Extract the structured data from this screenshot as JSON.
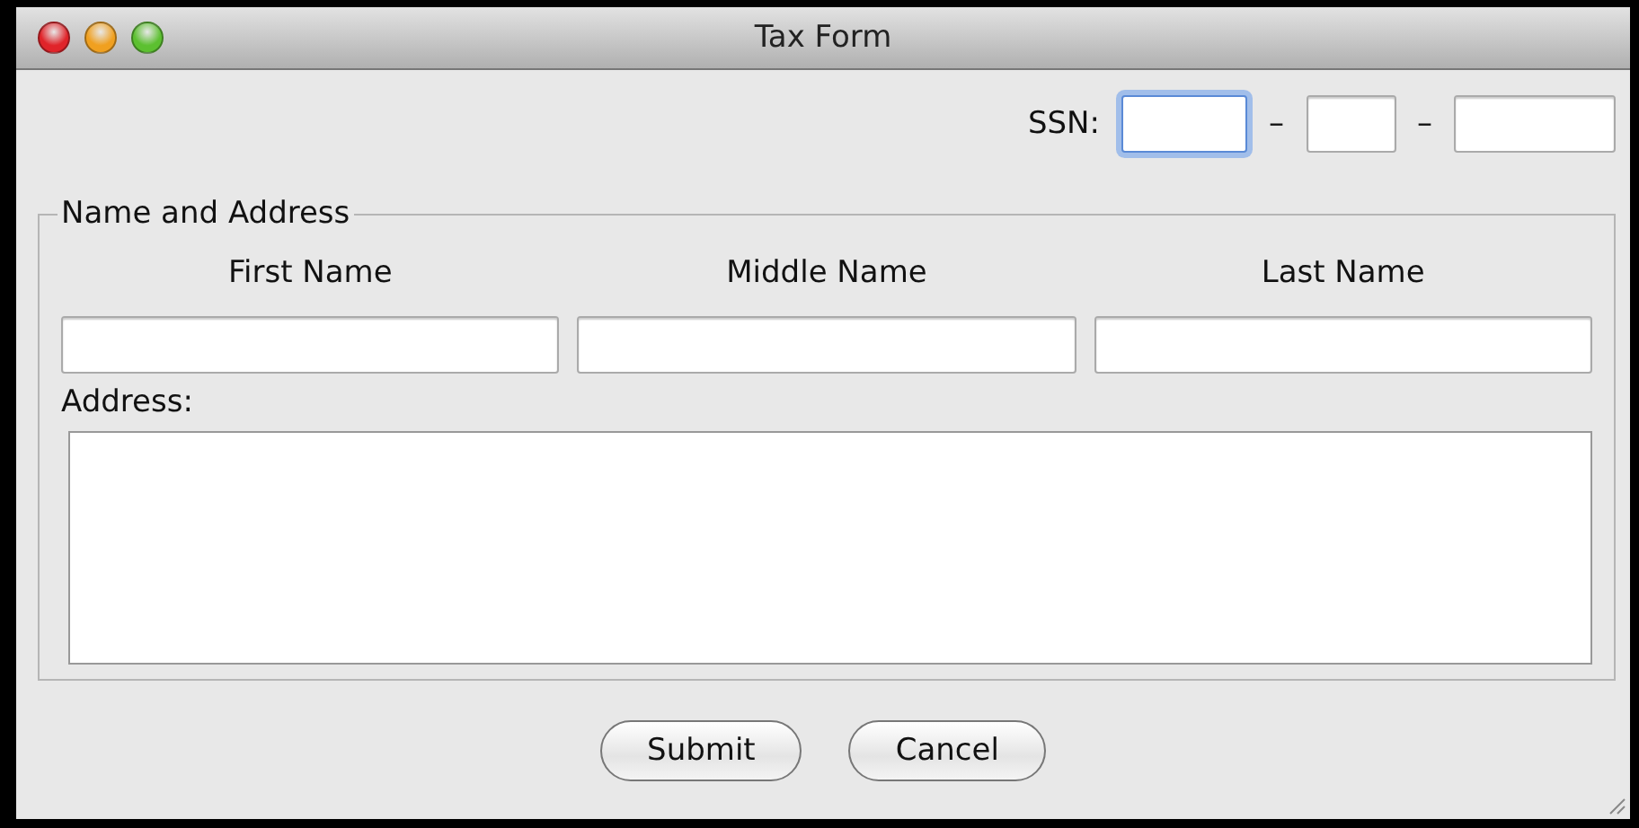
{
  "window": {
    "title": "Tax Form"
  },
  "ssn": {
    "label": "SSN:",
    "separators": [
      "–",
      "–"
    ],
    "fields": [
      {
        "focused": true
      },
      {
        "focused": false
      },
      {
        "focused": false
      }
    ]
  },
  "group": {
    "title": "Name and Address",
    "name_fields": [
      {
        "label": "First Name"
      },
      {
        "label": "Middle Name"
      },
      {
        "label": "Last Name"
      }
    ],
    "address_label": "Address:"
  },
  "buttons": [
    "Submit",
    "Cancel"
  ]
}
